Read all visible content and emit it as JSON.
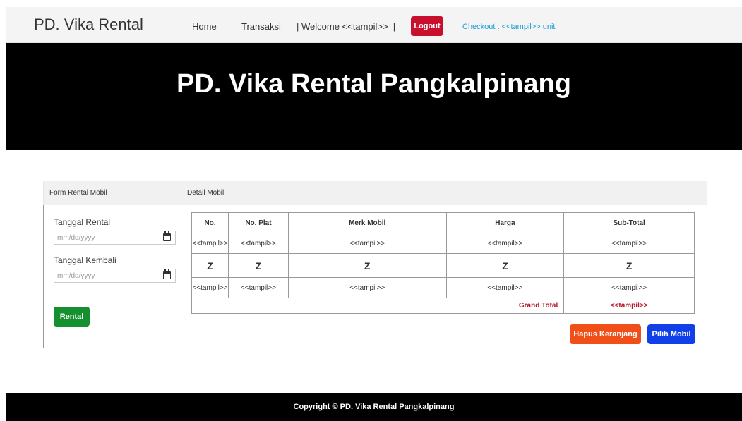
{
  "nav": {
    "brand": "PD. Vika Rental",
    "home": "Home",
    "transaksi": "Transaksi",
    "welcome": "| Welcome <<tampil>>  |",
    "logout": "Logout",
    "checkout": "Checkout : <<tampil>>  unit"
  },
  "hero": {
    "title": "PD. Vika Rental Pangkalpinang"
  },
  "panel": {
    "form_title": "Form Rental Mobil",
    "detail_title": "Detail Mobil"
  },
  "form": {
    "tanggal_rental_label": "Tanggal Rental",
    "tanggal_rental_placeholder": "mm/dd/yyyy",
    "tanggal_kembali_label": "Tanggal Kembali",
    "tanggal_kembali_placeholder": "mm/dd/yyyy",
    "rental_button": "Rental"
  },
  "table": {
    "headers": [
      "No.",
      "No. Plat",
      "Merk Mobil",
      "Harga",
      "Sub-Total"
    ],
    "rows": [
      [
        "<<tampil>>",
        "<<tampil>>",
        "<<tampil>>",
        "<<tampil>>",
        "<<tampil>>"
      ],
      [
        "Z",
        "Z",
        "Z",
        "Z",
        "Z"
      ],
      [
        "<<tampil>>",
        "<<tampil>>",
        "<<tampil>>",
        "<<tampil>>",
        "<<tampil>>"
      ]
    ],
    "grand_total_label": "Grand Total",
    "grand_total_value": "<<tampil>>"
  },
  "buttons": {
    "hapus": "Hapus Keranjang",
    "pilih": "Pilih Mobil"
  },
  "footer": {
    "text": "Copyright © PD. Vika Rental Pangkalpinang"
  },
  "colors": {
    "logout": "#c8102e",
    "rental": "#15902e",
    "hapus": "#f05018",
    "pilih": "#1240e8",
    "grand_total": "#b5192a",
    "link": "#1a9bd7"
  }
}
